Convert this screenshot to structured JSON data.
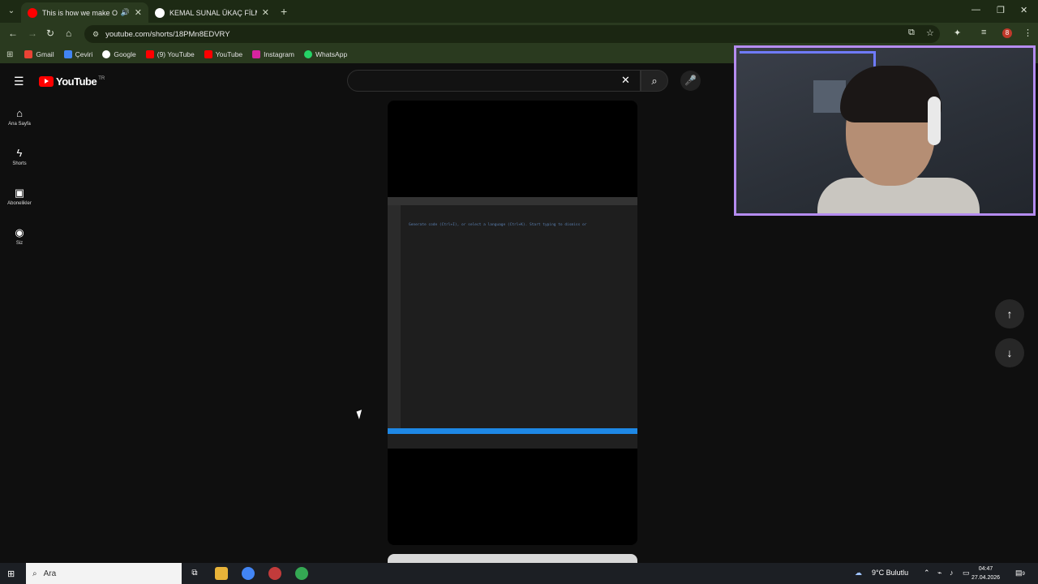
{
  "browser": {
    "tabs": [
      {
        "title": "This is how we make Orde...",
        "active": true,
        "favicon": "youtube-icon"
      },
      {
        "title": "KEMAL SUNAL ÜKAÇ FİLMDE Ö...",
        "active": false,
        "favicon": "google-icon"
      }
    ],
    "url": "youtube.com/shorts/18PMn8EDVRY",
    "bookmarks": [
      "Gmail",
      "Çeviri",
      "Google",
      "(9) YouTube",
      "YouTube",
      "Instagram",
      "WhatsApp"
    ],
    "profile_initial": "8"
  },
  "youtube": {
    "logo_text": "YouTube",
    "region": "TR",
    "search_value": "",
    "nav": [
      {
        "label": "Ana Sayfa",
        "icon": "home-icon"
      },
      {
        "label": "Shorts",
        "icon": "shorts-icon"
      },
      {
        "label": "Abonelikler",
        "icon": "subscriptions-icon"
      },
      {
        "label": "Siz",
        "icon": "you-icon"
      }
    ],
    "video_code_text": "Generate code (Ctrl+I), or select a language (Ctrl+K). Start typing to dismiss or"
  },
  "taskbar": {
    "search_placeholder": "Ara",
    "weather": "9°C Bulutlu",
    "time": "04:47",
    "date": "27.04.2026",
    "notifications": "9"
  },
  "colors": {
    "accent": "#ff0000",
    "browser_frame": "#2a3a1f",
    "webcam_border": "#b58cf0"
  }
}
